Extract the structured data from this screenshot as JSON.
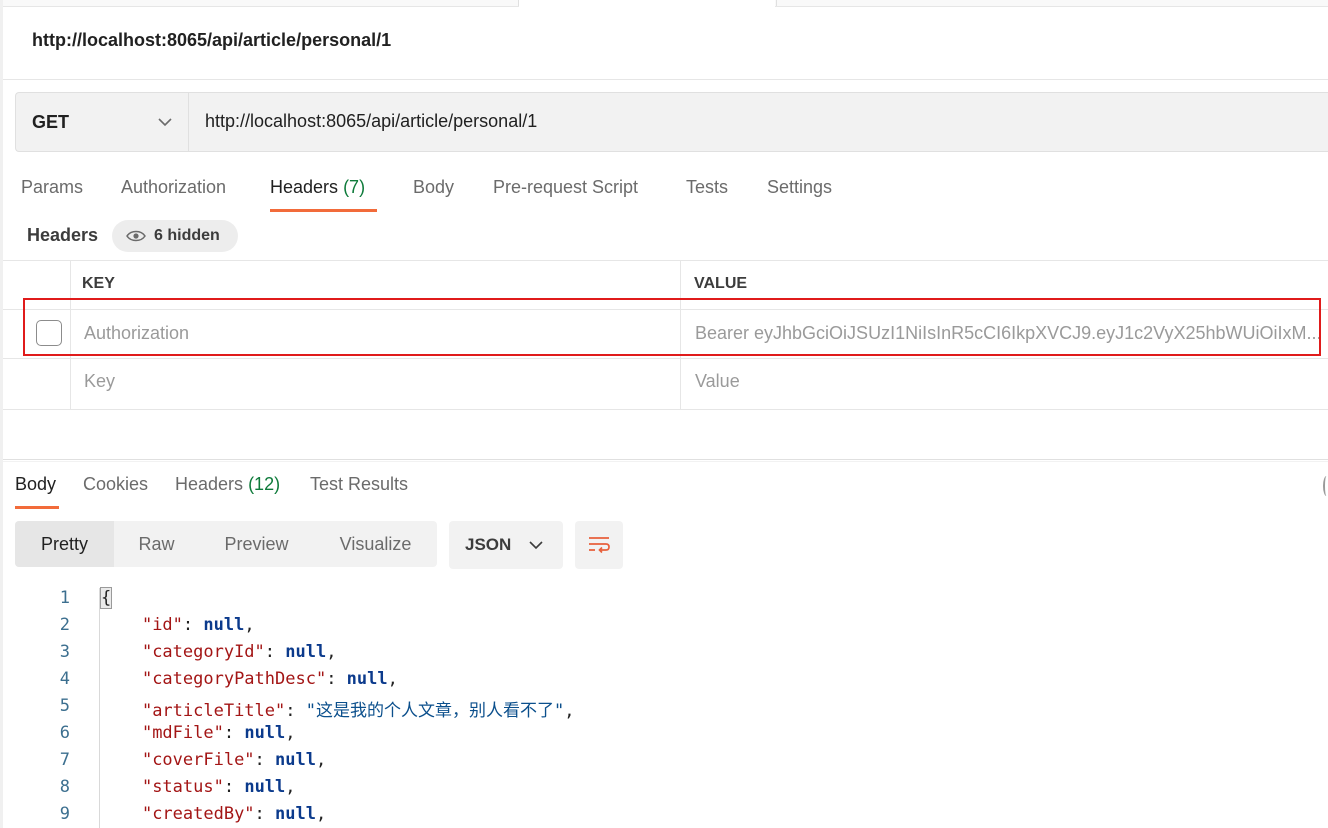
{
  "request": {
    "title": "http://localhost:8065/api/article/personal/1",
    "method": "GET",
    "url": "http://localhost:8065/api/article/personal/1"
  },
  "request_tabs": {
    "params": "Params",
    "authorization": "Authorization",
    "headers": "Headers",
    "headers_count": "(7)",
    "body": "Body",
    "prerequest": "Pre-request Script",
    "tests": "Tests",
    "settings": "Settings"
  },
  "headers_section": {
    "label": "Headers",
    "hidden_label": "6 hidden",
    "col_key": "KEY",
    "col_value": "VALUE",
    "rows": [
      {
        "key": "Authorization",
        "value": "Bearer eyJhbGciOiJSUzI1NiIsInR5cCI6IkpXVCJ9.eyJ1c2VyX25hbWUiOiIxM..."
      }
    ],
    "placeholder_key": "Key",
    "placeholder_value": "Value"
  },
  "response_tabs": {
    "body": "Body",
    "cookies": "Cookies",
    "headers": "Headers",
    "headers_count": "(12)",
    "test_results": "Test Results"
  },
  "view_modes": {
    "pretty": "Pretty",
    "raw": "Raw",
    "preview": "Preview",
    "visualize": "Visualize",
    "format": "JSON"
  },
  "code": {
    "line_numbers": [
      "1",
      "2",
      "3",
      "4",
      "5",
      "6",
      "7",
      "8",
      "9"
    ],
    "open_brace": "{",
    "lines": [
      {
        "key": "\"id\"",
        "value": "null"
      },
      {
        "key": "\"categoryId\"",
        "value": "null"
      },
      {
        "key": "\"categoryPathDesc\"",
        "value": "null"
      },
      {
        "key": "\"articleTitle\"",
        "value": "\"这是我的个人文章，别人看不了\""
      },
      {
        "key": "\"mdFile\"",
        "value": "null"
      },
      {
        "key": "\"coverFile\"",
        "value": "null"
      },
      {
        "key": "\"status\"",
        "value": "null"
      },
      {
        "key": "\"createdBy\"",
        "value": "null"
      }
    ]
  },
  "colors": {
    "accent": "#f26b3a",
    "count_green": "#0f7b3b",
    "highlight_red": "#e01b1b"
  }
}
